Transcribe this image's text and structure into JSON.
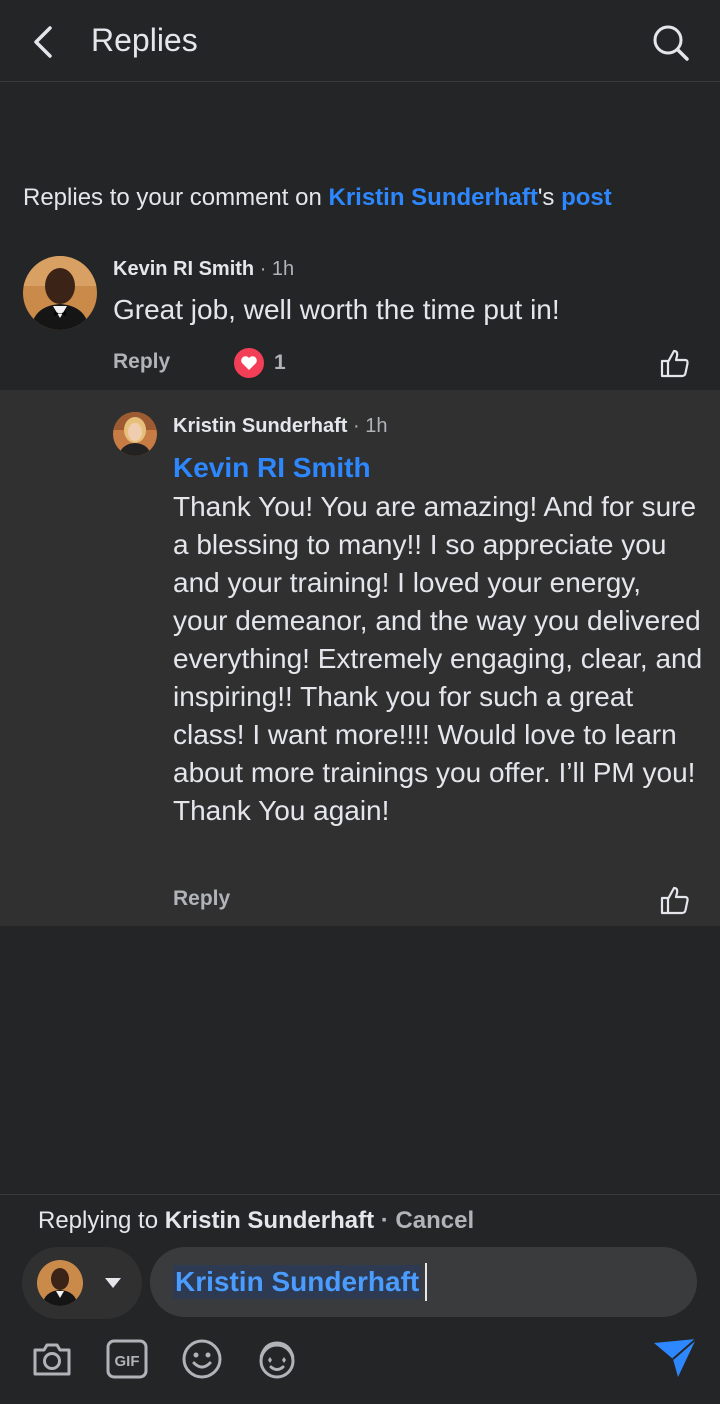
{
  "header": {
    "title": "Replies"
  },
  "context": {
    "prefix": "Replies to your comment on ",
    "author": "Kristin Sunderhaft",
    "possessive": "'s ",
    "post_link": "post"
  },
  "comments": [
    {
      "author": "Kevin RI Smith",
      "time": " · 1h",
      "text": "Great job, well worth the time put in!",
      "reply_label": "Reply",
      "reaction_count": "1"
    },
    {
      "author": "Kristin Sunderhaft",
      "time": " · 1h",
      "mention": "Kevin RI Smith",
      "text": "Thank You! You are amazing! And for sure a blessing to many!! I so appreciate you and your training! I loved your energy, your demeanor, and the way you delivered everything! Extremely engaging, clear, and inspiring!! Thank you for such a great class! I want more!!!! Would love to learn about more trainings you offer. I’ll PM you! Thank You again!",
      "reply_label": "Reply"
    }
  ],
  "composer": {
    "replying_prefix": "Replying to ",
    "replying_to": "Kristin Sunderhaft",
    "separator": " · ",
    "cancel_label": "Cancel",
    "input_mention": "Kristin Sunderhaft"
  },
  "colors": {
    "accent": "#2d88ff",
    "heart": "#f33e58",
    "background": "#242526",
    "highlight": "#303031"
  }
}
